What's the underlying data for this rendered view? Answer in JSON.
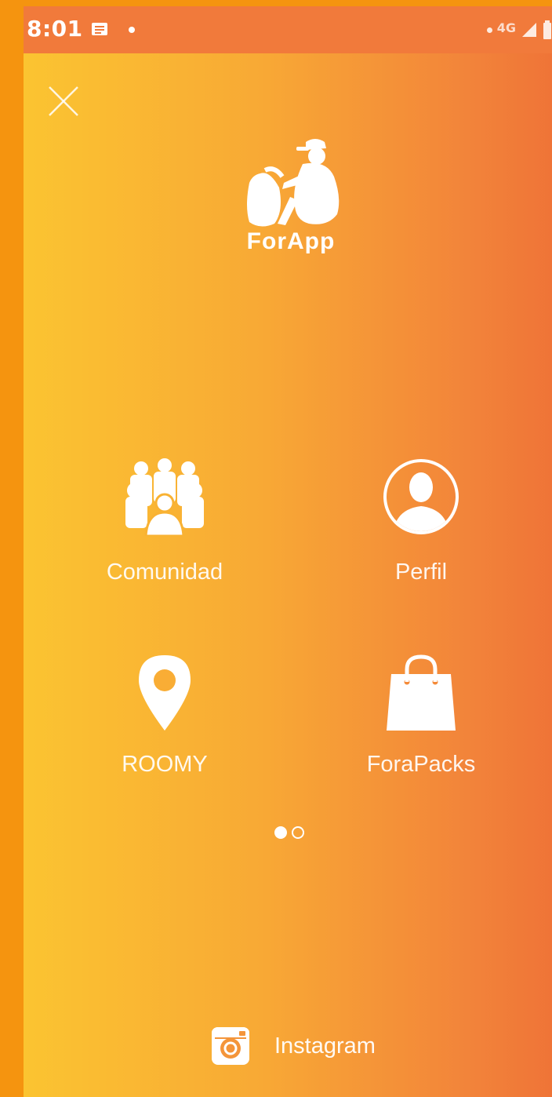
{
  "status_bar": {
    "time": "8:01",
    "network": "4G"
  },
  "logo": {
    "text": "ForApp"
  },
  "menu": {
    "items": [
      {
        "label": "Comunidad",
        "icon": "community-icon"
      },
      {
        "label": "Perfil",
        "icon": "profile-icon"
      },
      {
        "label": "ROOMY",
        "icon": "location-pin-icon"
      },
      {
        "label": "ForaPacks",
        "icon": "shopping-bag-icon"
      }
    ]
  },
  "pager": {
    "current_page": 1,
    "total_pages": 2
  },
  "footer": {
    "instagram_label": "Instagram"
  },
  "colors": {
    "gradient_start": "#fbc431",
    "gradient_end": "#ef7437",
    "status_bar": "#f17a3b",
    "outer_background": "#f5940f"
  }
}
